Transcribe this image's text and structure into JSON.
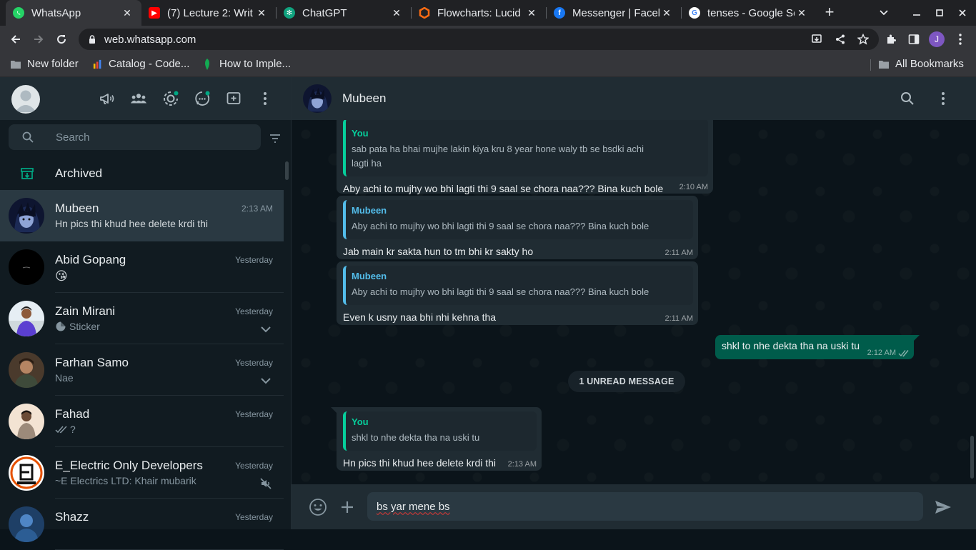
{
  "browser": {
    "tabs": [
      {
        "title": "WhatsApp",
        "favicon": "whatsapp-icon",
        "active": true
      },
      {
        "title": "(7) Lecture 2: Writ",
        "favicon": "youtube-icon"
      },
      {
        "title": "ChatGPT",
        "favicon": "chatgpt-icon"
      },
      {
        "title": "Flowcharts: Lucid",
        "favicon": "lucid-icon"
      },
      {
        "title": "Messenger | Faceb",
        "favicon": "facebook-icon"
      },
      {
        "title": "tenses - Google Se",
        "favicon": "google-icon"
      }
    ],
    "url": "web.whatsapp.com",
    "profile_initial": "J",
    "bookmarks": [
      {
        "label": "New folder",
        "icon": "folder-icon"
      },
      {
        "label": "Catalog - Code...",
        "icon": "catalog-icon"
      },
      {
        "label": "How to Imple...",
        "icon": "leaf-icon"
      }
    ],
    "all_bookmarks": "All Bookmarks"
  },
  "sidebar": {
    "search_placeholder": "Search",
    "archived_label": "Archived",
    "chats": [
      {
        "name": "Mubeen",
        "time": "2:13 AM",
        "preview": "Hn pics thi khud hee delete krdi thi",
        "selected": true,
        "avatar": "anime"
      },
      {
        "name": "Abid Gopang",
        "time": "Yesterday",
        "preview": "😘",
        "avatar": "dark"
      },
      {
        "name": "Zain Mirani",
        "time": "Yesterday",
        "preview": "Sticker",
        "avatar": "person-blue",
        "side": "chevron"
      },
      {
        "name": "Farhan Samo",
        "time": "Yesterday",
        "preview": "Nae",
        "avatar": "person-warm",
        "side": "chevron"
      },
      {
        "name": "Fahad",
        "time": "Yesterday",
        "preview": "?",
        "avatar": "person-light"
      },
      {
        "name": "E_Electric Only Developers",
        "time": "Yesterday",
        "preview": "~E Electrics LTD: Khair mubarik",
        "avatar": "logo",
        "side": "muted"
      },
      {
        "name": "Shazz",
        "time": "Yesterday",
        "preview": "",
        "avatar": "person-blue2"
      }
    ]
  },
  "conversation": {
    "contact_name": "Mubeen",
    "messages": [
      {
        "dir": "in",
        "quote_author": "You",
        "quote_text": "sab pata ha bhai mujhe lakin kiya kru 8 year hone waly tb se bsdki achi lagti ha",
        "text": "Aby achi to mujhy  wo bhi lagti thi 9 saal se chora naa??? Bina kuch bole",
        "time": "2:10 AM"
      },
      {
        "dir": "in",
        "quote_author": "Mubeen",
        "quote_text": "Aby achi to mujhy  wo bhi lagti thi 9 saal se chora naa??? Bina kuch bole",
        "text": "Jab main kr sakta hun to tm bhi kr sakty ho",
        "time": "2:11 AM"
      },
      {
        "dir": "in",
        "quote_author": "Mubeen",
        "quote_text": "Aby achi to mujhy  wo bhi lagti thi 9 saal se chora naa??? Bina kuch bole",
        "text": "Even k usny naa bhi nhi kehna tha",
        "time": "2:11 AM"
      },
      {
        "dir": "out",
        "text": "shkl to nhe dekta tha na uski tu",
        "time": "2:12 AM"
      },
      {
        "dir": "in",
        "quote_author": "You",
        "quote_text": "shkl to nhe dekta tha na uski tu",
        "text": "Hn pics thi khud hee delete krdi thi",
        "time": "2:13 AM"
      }
    ],
    "unread_label": "1 UNREAD MESSAGE",
    "composer_text": "bs yar mene bs"
  },
  "colors": {
    "accent_green": "#06cf9c",
    "quote_blue": "#53bdeb",
    "outgoing_bubble": "#005c4b",
    "incoming_bubble": "#202c33"
  }
}
